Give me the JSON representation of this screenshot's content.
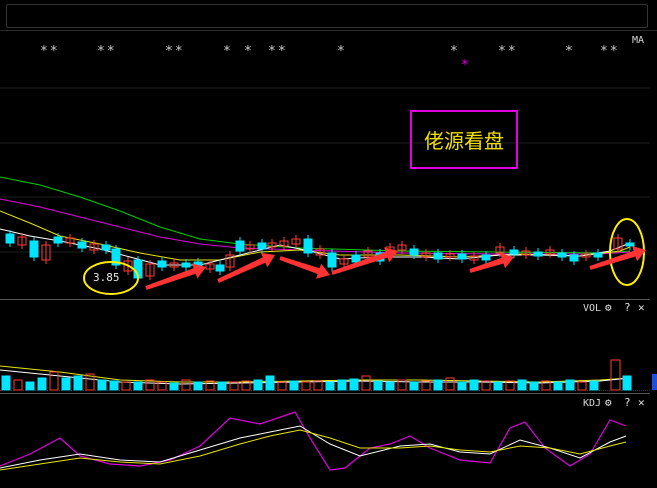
{
  "main_chart": {
    "indicator_label": "MA",
    "star_markers": [
      "**",
      "**",
      "**",
      "*",
      "*",
      "**",
      "*",
      "*",
      "**",
      "*",
      "**"
    ],
    "magenta_marker": "*",
    "annotation_price": "3.85",
    "watermark_text": "佬源看盘"
  },
  "volume_panel": {
    "label": "VOL",
    "settings_icon": "gear-icon",
    "help_label": "?",
    "close_label": "✕"
  },
  "kdj_panel": {
    "label": "KDJ",
    "settings_icon": "gear-icon",
    "help_label": "?",
    "close_label": "✕"
  },
  "colors": {
    "up_candle": "#ff3b3b",
    "down_candle": "#00e5ff",
    "ma_white": "#ffffff",
    "ma_yellow": "#e6e600",
    "ma_magenta": "#e000e0",
    "ma_green": "#00d000",
    "annotation_ellipse": "#ffee00",
    "arrow": "#ff3333",
    "watermark_border": "#e000e0",
    "watermark_text": "#f0e000"
  }
}
